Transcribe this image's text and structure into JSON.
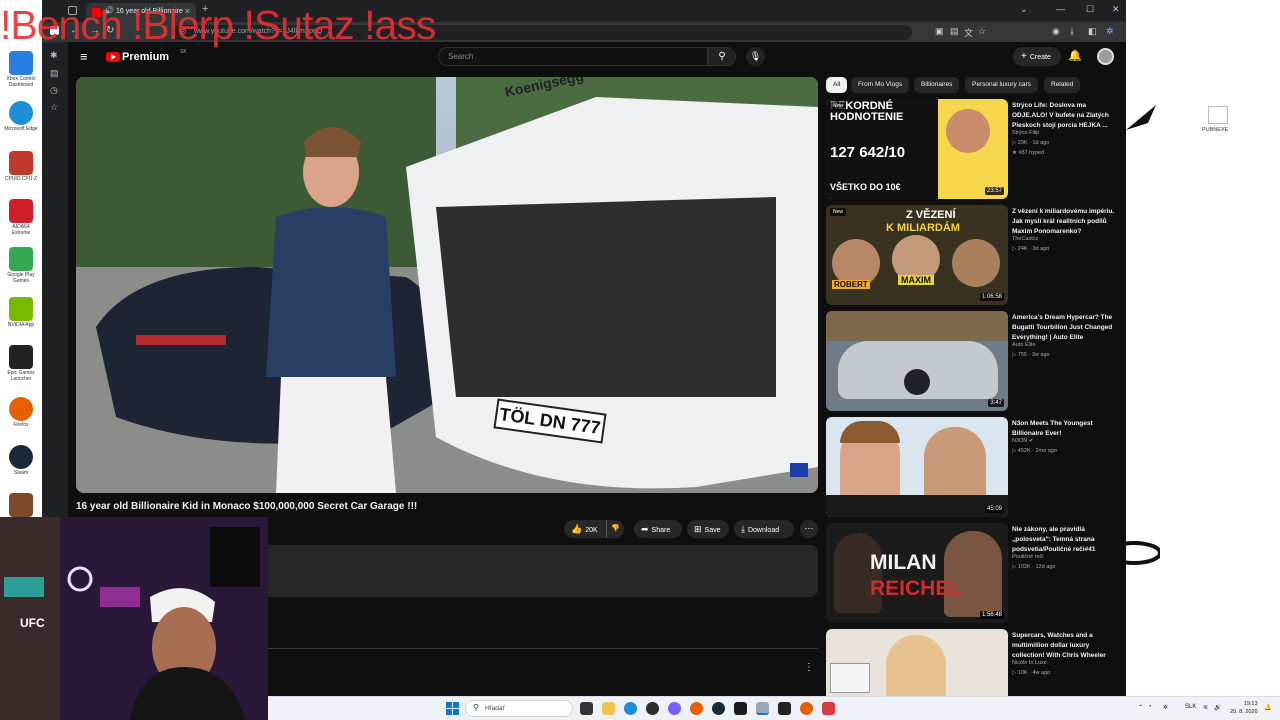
{
  "overlay": {
    "text": "!Bench !Blerp !Sutaz !ass"
  },
  "desktop_icons": [
    {
      "label": "Xbox Control Dashboard",
      "color": "#2a7de1"
    },
    {
      "label": "Microsoft Edge",
      "color": "#1c8fd6"
    },
    {
      "label": "CPUID CPU-Z",
      "color": "#c0392b"
    },
    {
      "label": "AIDA64 Extreme",
      "color": "#d11f2a"
    },
    {
      "label": "Google Play Games",
      "color": "#34a853"
    },
    {
      "label": "NVIDIA App",
      "color": "#1a1a1a"
    },
    {
      "label": "Epic Games Launcher",
      "color": "#222222"
    },
    {
      "label": "Firefox",
      "color": "#e66000"
    },
    {
      "label": "Steam",
      "color": "#1b2838"
    },
    {
      "label": "",
      "color": "#7a4a2a"
    }
  ],
  "right_desktop_icon": {
    "label": "PUBNEXE"
  },
  "browser": {
    "tab_title": "16 year old Billionaire",
    "url": "www.youtube.com/watch?v=_J4lkmZpqQ"
  },
  "youtube": {
    "logo_text": "Premium",
    "logo_region": "SK",
    "search_placeholder": "Search",
    "create_label": "Create",
    "video_title": "16 year old Billionaire Kid in Monaco $100,000,000 Secret Car Garage !!!",
    "like_count": "20K",
    "share_label": "Share",
    "save_label": "Save",
    "download_label": "Download",
    "chips": [
      "All",
      "From Mo Vlogs",
      "Billionaires",
      "Personal luxury cars",
      "Related"
    ],
    "recommendations": [
      {
        "title": "Strýco Life: Doslova ma ODJE.ALO! V bufete na Zlatých Pieskoch stojí porcia HEJKA ...",
        "channel": "Strýco Filip",
        "meta": "29K · 1d ago",
        "extra": "#87 hyped",
        "duration": "23:57",
        "new": true,
        "thumb_text": [
          "REKORDNÉ",
          "HODNOTENIE",
          "127 642/10",
          "VŠETKO DO 10€"
        ]
      },
      {
        "title": "Z vězení k miliardovému impériu. Jak myslí král realitních podílů Maxim Ponomarenko?",
        "channel": "TheCastcz",
        "meta": "24K · 3d ago",
        "extra": "",
        "duration": "1:06:58",
        "new": true,
        "thumb_text": [
          "Z VĚZENÍ",
          "K MILIARDÁM",
          "ROBERT",
          "MAXIM"
        ]
      },
      {
        "title": "America's Dream Hypercar? The Bugatti Tourbillon Just Changed Everything! | Auto Elite",
        "channel": "Auto Elite",
        "meta": "755 · 3w ago",
        "extra": "",
        "duration": "3:47",
        "new": false,
        "thumb_text": []
      },
      {
        "title": "N3on Meets The Youngest Billionaire Ever!",
        "channel": "N3ON",
        "meta": "452K · 2mo ago",
        "extra": "",
        "duration": "45:09",
        "new": false,
        "thumb_text": []
      },
      {
        "title": "Nie zákony, ale pravidlá „polosveta\": Temná strana podsvetia/Pouličné reči#41",
        "channel": "Pouličné reči",
        "meta": "103K · 12d ago",
        "extra": "",
        "duration": "1:56:48",
        "new": false,
        "thumb_text": [
          "MILAN",
          "REICHEL"
        ]
      },
      {
        "title": "Supercars, Watches and a multimillion dollar luxury collection! With Chris Wheeler",
        "channel": "Nicole In Luxe",
        "meta": "10K · 4w ago",
        "extra": "",
        "duration": "",
        "new": false,
        "thumb_text": []
      }
    ]
  },
  "taskbar": {
    "search_placeholder": "Hľadať",
    "lang": "SLK",
    "time": "19:13",
    "date": "20. 8. 2026"
  },
  "player_overlay": {
    "plate": "TÖL DN 777",
    "brand": "Koenigsegg"
  },
  "colors": {
    "yt_bg": "#0f0f0f",
    "yt_red": "#ff0000",
    "chip_bg": "#272727"
  }
}
